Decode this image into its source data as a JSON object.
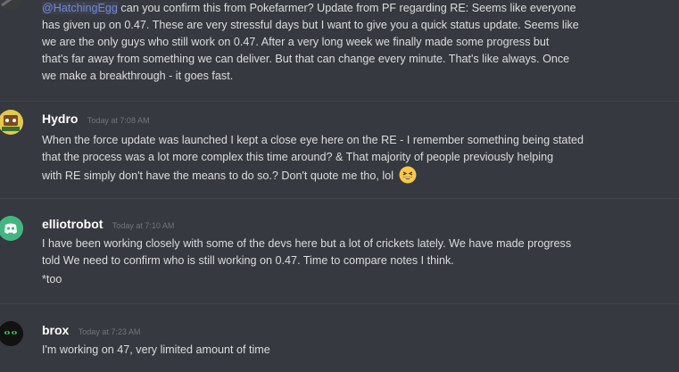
{
  "messages": [
    {
      "mention": "@HatchingEgg",
      "lines": [
        " can you confirm this from Pokefarmer? Update from PF regarding RE:   Seems like everyone",
        "has given up on 0.47. These are very stressful days but I want to give you a quick status update. Seems like",
        "we are the only guys who still work on 0.47. After a very long week we finally made some progress but",
        "that's far away from something we can deliver. But that can change every minute. That's like always. Once",
        "we make a breakthrough - it goes fast."
      ]
    },
    {
      "username": "Hydro",
      "timestamp": "Today at 7:08 AM",
      "lines": [
        "When the force update was launched I kept a close eye here on the RE - I remember something being stated",
        "that the process was a lot more complex this time around? & That majority of people previously helping",
        "with RE simply don't have the means to do so.? Don't quote me tho, lol"
      ],
      "emoji": "grinning-squinting-face"
    },
    {
      "username": "elliotrobot",
      "timestamp": "Today at 7:10 AM",
      "lines": [
        "I have been working closely with some of the devs here but a lot of crickets lately. We have made progress",
        "told We need to confirm who is still working on 0.47. Time to compare notes I think.",
        "*too"
      ]
    },
    {
      "username": "brox",
      "timestamp": "Today at 7:23 AM",
      "lines": [
        "I'm working on 47, very limited amount of time"
      ]
    }
  ],
  "colors": {
    "background": "#36393f",
    "mention": "#7289da",
    "discord_blurple": "#7289da"
  }
}
